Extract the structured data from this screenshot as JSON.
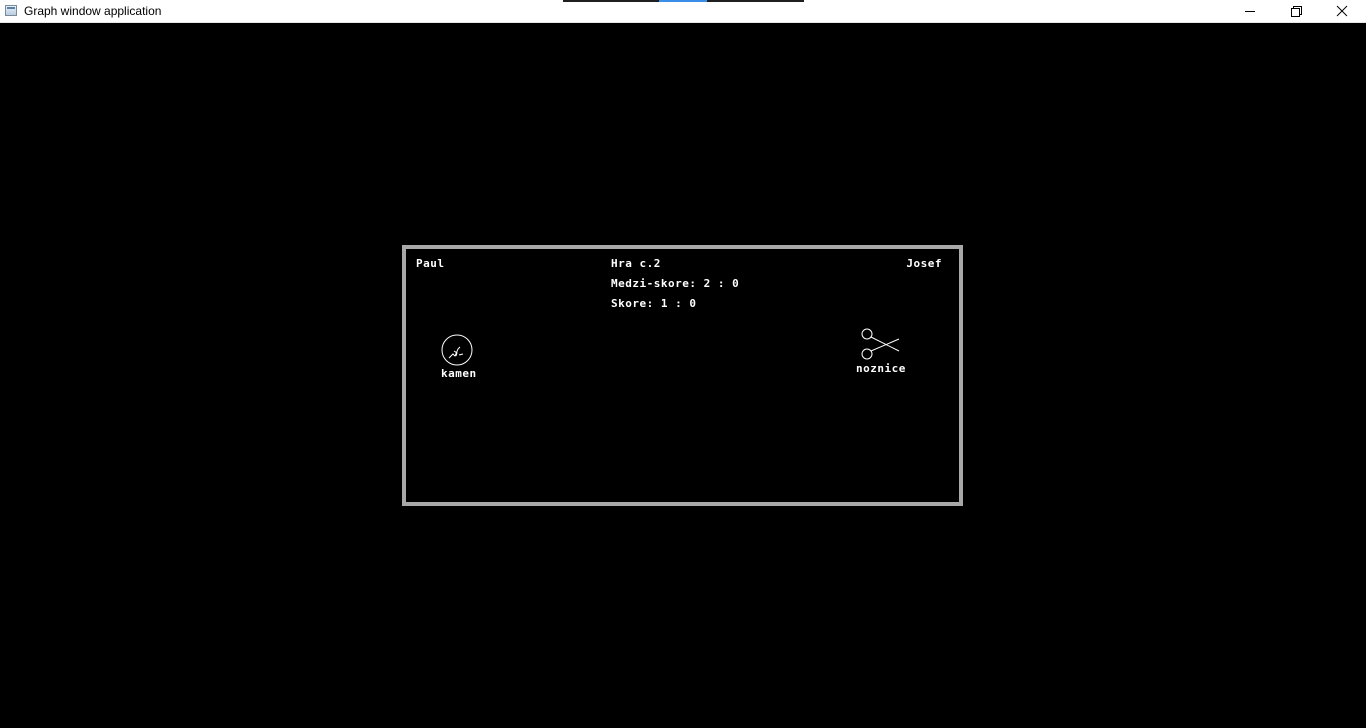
{
  "window": {
    "title": "Graph window application",
    "controls": {
      "minimize": "minimize-icon",
      "maximize": "restore-icon",
      "close": "close-icon"
    }
  },
  "game": {
    "player_left": "Paul",
    "player_right": "Josef",
    "game_number": "Hra c.2",
    "sub_score": "Medzi-skore: 2 : 0",
    "score": "Skore: 1 : 0",
    "left_choice": {
      "label": "kamen",
      "icon": "rock-icon"
    },
    "right_choice": {
      "label": "noznice",
      "icon": "scissors-icon"
    }
  },
  "colors": {
    "background": "#000000",
    "panel_border": "#a8a8a8",
    "text": "#ffffff"
  }
}
